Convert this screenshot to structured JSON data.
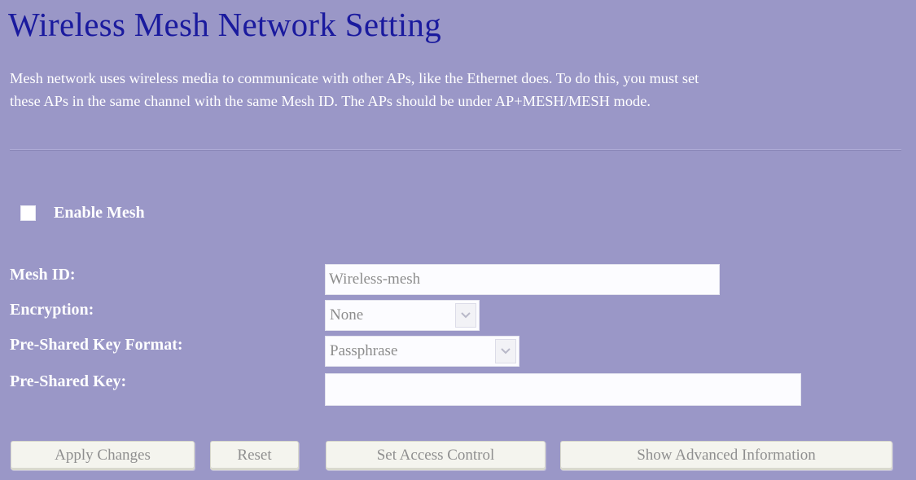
{
  "page": {
    "title": "Wireless Mesh Network Setting",
    "description_line1": "Mesh network uses wireless media to communicate with other APs, like the Ethernet does. To do this, you must set",
    "description_line2": "these APs in the same channel with the same Mesh ID. The APs should be under AP+MESH/MESH mode."
  },
  "enable_mesh": {
    "label": "Enable Mesh",
    "checked": false
  },
  "form": {
    "mesh_id": {
      "label": "Mesh ID:",
      "value": "Wireless-mesh"
    },
    "encryption": {
      "label": "Encryption:",
      "selected": "None"
    },
    "psk_format": {
      "label": "Pre-Shared Key Format:",
      "selected": "Passphrase"
    },
    "psk": {
      "label": "Pre-Shared Key:",
      "value": ""
    }
  },
  "buttons": {
    "apply": "Apply Changes",
    "reset": "Reset",
    "access_control": "Set Access Control",
    "advanced_info": "Show Advanced Information"
  },
  "colors": {
    "background": "#9a97c7",
    "title": "#1a1a9e",
    "text": "#ffffff"
  }
}
